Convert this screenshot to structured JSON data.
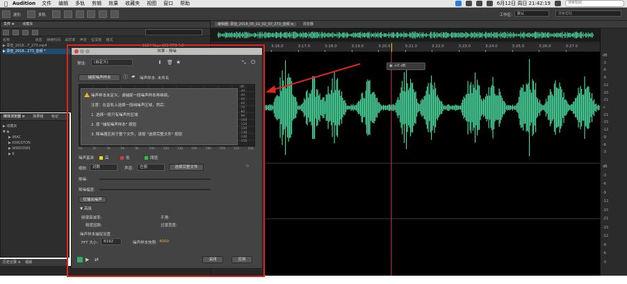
{
  "menubar": {
    "app_name": "Audition",
    "items": [
      "文件",
      "编辑",
      "多轨",
      "剪辑",
      "效果",
      "收藏夹",
      "视图",
      "窗口",
      "帮助"
    ],
    "clock": "6月12日 周日 21:42:19",
    "search_placeholder": "搜索帮助"
  },
  "toolbar": {
    "waveform_label": "波形",
    "multitrack_label": "多轨",
    "workspace_label": "工作区:",
    "workspace_value": "默认",
    "search_placeholder": "搜索帮助"
  },
  "files_panel": {
    "tabs": [
      "文件 ≡",
      "收藏夹"
    ],
    "columns": [
      "名称",
      "状态",
      "持续时间",
      "采样率",
      "声道",
      "位深度",
      "格式"
    ],
    "files": [
      {
        "name": "▶ 录音_2016...T_273.mp4",
        "duration": "",
        "samplerate": "",
        "extra": "1024 Kbps 256 MP3 4:0"
      },
      {
        "name": "▶ 录音_2016...273_音频 *",
        "duration": "",
        "samplerate": "",
        "extra": ""
      }
    ]
  },
  "media_panel": {
    "tabs": [
      "媒体浏览器 ≡",
      "效果组",
      "标记"
    ],
    "content_label": "内容:",
    "items": [
      "▶ 收藏夹",
      "▼ ◉",
      "▶ IMAC",
      "▶ KINGSTON",
      "▶ WINDOWS",
      "▶ 8"
    ]
  },
  "history_panel": {
    "tabs": [
      "历史记录 ≡",
      "视频"
    ]
  },
  "editor": {
    "title": "编辑器: 录音_2016_05_11_02_07_273_音频 ≡",
    "mixer_tab": "混音器",
    "ticks": [
      "3:16.0",
      "3:17.0",
      "3:18.0",
      "3:19.0",
      "3:20.0",
      "3:21.0",
      "3:22.0",
      "3:23.0",
      "3:24.0",
      "3:25.0",
      "3:26.0",
      "3:27.0"
    ],
    "float_value": "+0 dB",
    "ruler_top": [
      "dB",
      "-3",
      "-6",
      "-9",
      "-12",
      "-15",
      "-21",
      "∞",
      "-21",
      "-15",
      "-12",
      "-9",
      "-6",
      "-3"
    ],
    "ruler_bottom": [
      "dB",
      "-3",
      "-6",
      "-9",
      "-12",
      "-15",
      "-21",
      "-15",
      "-12",
      "-9",
      "-6",
      "-3"
    ]
  },
  "dialog": {
    "title": "效果 - 降噪",
    "preset_label": "预设:",
    "preset_value": "(自定义)",
    "capture_button": "捕捉噪声样本",
    "noise_sample_label": "噪声样本: 未命名",
    "message": {
      "line1": "噪声样本未定义。请捕捉一段噪声样本再继续。",
      "line2": "注意：在音轨上选择一段纯噪声区域，然后：",
      "line3": "1. 选择一段只有噪声的区域",
      "line4": "2. 按 \"捕捉噪声样本\" 按钮",
      "line5": "3. 降噪器应用于整个文件，请按 \"选择完整文件\" 按钮"
    },
    "graph_x_labels": [
      "Hz",
      "2k",
      "4k",
      "6k",
      "8k",
      "10k",
      "12k",
      "14k",
      "16k",
      "18k",
      "20k",
      "22k",
      "24k"
    ],
    "graph_y_labels": [
      "dB",
      "-30",
      "-40",
      "-50",
      "-60",
      "-70",
      "-80",
      "-90",
      "-100",
      "-110",
      "-120",
      "-130",
      "-140",
      "-150"
    ],
    "noise_floor_label": "噪声基准",
    "legend": [
      {
        "label": "高",
        "color": "#e6d81f"
      },
      {
        "label": "低",
        "color": "#d93a2f"
      },
      {
        "label": "阈值",
        "color": "#2fbf4a"
      }
    ],
    "scale_label": "缩放:",
    "scale_value": "对数",
    "channel_label": "声道:",
    "channel_value": "左侧",
    "select_entire_file": "选择完整文件",
    "reduce_label": "降噪:",
    "reduce_by_label": "降噪幅度:",
    "output_noise_only": "仅输出噪声",
    "advanced_label": "高级",
    "spectral_decay_label": "频谱衰减率:",
    "smoothing_label": "平滑:",
    "precision_label": "精度因数:",
    "transition_label": "过渡宽度:",
    "noise_settings_label": "噪声样本捕捉设置",
    "fft_label": "FFT 大小:",
    "fft_value": "8192",
    "snapshots_label": "噪声样本快照:",
    "snapshots_value": "4000",
    "close_button": "关闭",
    "apply_button": "应用"
  }
}
